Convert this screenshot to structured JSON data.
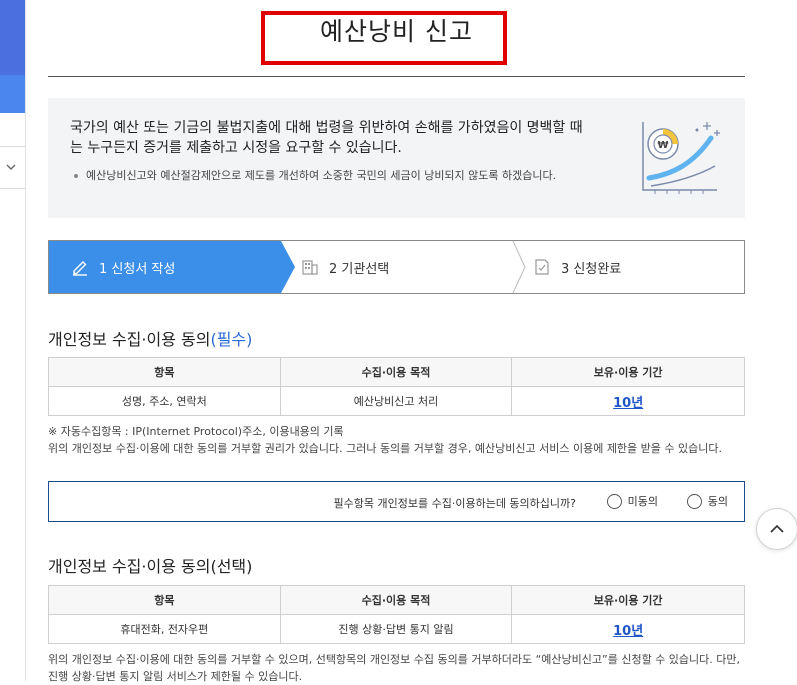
{
  "page": {
    "title": "예산낭비 신고"
  },
  "intro": {
    "lead": "국가의 예산 또는 기금의 불법지출에 대해 법령을 위반하여 손해를 가하였음이 명백할 때는 누구든지 증거를 제출하고 시정을 요구할 수 있습니다.",
    "note": "예산낭비신고와 예산절감제안으로 제도를 개선하여 소중한 국민의 세금이 낭비되지 않도록 하겠습니다.",
    "illus_icon": "growth-chart-coin-icon",
    "coin_symbol": "₩"
  },
  "steps": [
    {
      "label": "1 신청서 작성",
      "icon": "pencil-icon",
      "active": true
    },
    {
      "label": "2 기관선택",
      "icon": "building-icon",
      "active": false
    },
    {
      "label": "3 신청완료",
      "icon": "document-check-icon",
      "active": false
    }
  ],
  "required_section": {
    "title": "개인정보 수집·이용 동의",
    "badge": "(필수)",
    "headers": [
      "항목",
      "수집·이용 목적",
      "보유·이용 기간"
    ],
    "row": [
      "성명, 주소, 연락처",
      "예산낭비신고 처리",
      "10년"
    ],
    "auto_note": "※ 자동수집항목 : IP(Internet Protocol)주소, 이용내용의 기록",
    "refuse_note": "위의 개인정보 수집·이용에 대한 동의를 거부할 권리가 있습니다. 그러나 동의를 거부할 경우, 예산낭비신고 서비스 이용에 제한을 받을 수 있습니다.",
    "question": "필수항목 개인정보를 수집·이용하는데 동의하십니까?",
    "option_no": "미동의",
    "option_yes": "동의"
  },
  "optional_section": {
    "title": "개인정보 수집·이용 동의(선택)",
    "headers": [
      "항목",
      "수집·이용 목적",
      "보유·이용 기간"
    ],
    "row": [
      "휴대전화, 전자우편",
      "진행 상황·답변 통지 알림",
      "10년"
    ],
    "note": "위의 개인정보 수집·이용에 대한 동의를 거부할 수 있으며, 선택항목의 개인정보 수집 동의를 거부하더라도 “예산낭비신고”를 신청할 수 있습니다. 다만, 진행 상황·답변 통지 알림 서비스가 제한될 수 있습니다."
  },
  "colors": {
    "active_step": "#3b8fe8",
    "title_highlight": "#e00000",
    "required_badge": "#2a6cd6",
    "period_link": "#1f56c8",
    "agree_border": "#1f4c8c"
  }
}
